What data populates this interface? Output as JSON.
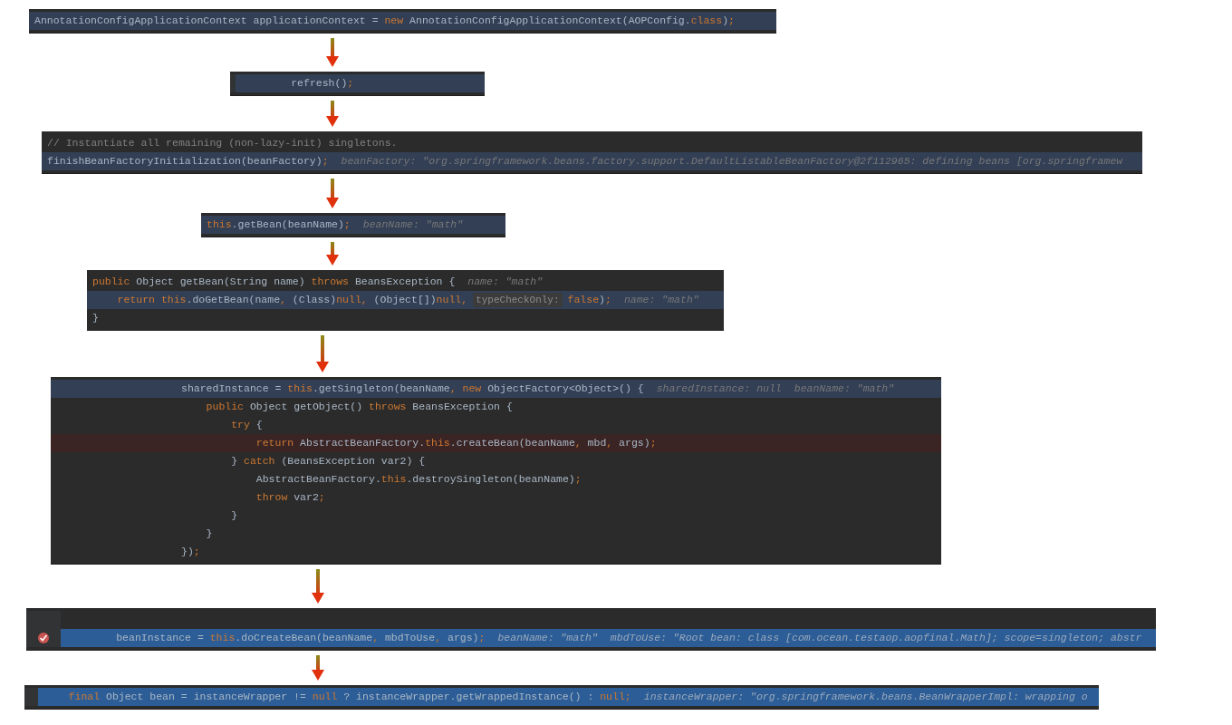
{
  "snippets": [
    {
      "lines": [
        {
          "kind": "caret",
          "parts": [
            {
              "kind": "plain",
              "text": "AnnotationConfigApplicationContext applicationContext = "
            },
            {
              "kind": "keyword",
              "text": "new"
            },
            {
              "kind": "plain",
              "text": " AnnotationConfigApplicationContext(AOPConfig."
            },
            {
              "kind": "keyword",
              "text": "class"
            },
            {
              "kind": "plain",
              "text": ")"
            },
            {
              "kind": "keyword",
              "text": ";"
            }
          ]
        }
      ]
    },
    {
      "lines": [
        {
          "kind": "caret",
          "parts": [
            {
              "kind": "plain",
              "text": "        refresh()"
            },
            {
              "kind": "keyword",
              "text": ";"
            }
          ]
        }
      ]
    },
    {
      "lines": [
        {
          "kind": "normal",
          "parts": [
            {
              "kind": "comment",
              "text": "// Instantiate all remaining (non-lazy-init) singletons."
            }
          ]
        },
        {
          "kind": "caret",
          "parts": [
            {
              "kind": "plain",
              "text": "finishBeanFactoryInitialization(beanFactory)"
            },
            {
              "kind": "keyword",
              "text": ";"
            },
            {
              "kind": "hint",
              "text": "beanFactory: \"org.springframework.beans.factory.support.DefaultListableBeanFactory@2f112965: defining beans [org.springframew"
            }
          ]
        }
      ]
    },
    {
      "lines": [
        {
          "kind": "caret",
          "parts": [
            {
              "kind": "keyword",
              "text": "this"
            },
            {
              "kind": "plain",
              "text": ".getBean(beanName)"
            },
            {
              "kind": "keyword",
              "text": ";"
            },
            {
              "kind": "hint",
              "text": "beanName: \"math\""
            }
          ]
        }
      ]
    },
    {
      "lines": [
        {
          "kind": "normal",
          "parts": [
            {
              "kind": "keyword",
              "text": "public"
            },
            {
              "kind": "plain",
              "text": " Object getBean(String name) "
            },
            {
              "kind": "keyword",
              "text": "throws"
            },
            {
              "kind": "plain",
              "text": " BeansException {"
            },
            {
              "kind": "hint",
              "text": "name: \"math\""
            }
          ]
        },
        {
          "kind": "caret",
          "parts": [
            {
              "kind": "keyword",
              "text": "    return this"
            },
            {
              "kind": "plain",
              "text": ".doGetBean(name"
            },
            {
              "kind": "keyword",
              "text": ","
            },
            {
              "kind": "plain",
              "text": " (Class)"
            },
            {
              "kind": "keyword",
              "text": "null,"
            },
            {
              "kind": "plain",
              "text": " (Object[])"
            },
            {
              "kind": "keyword",
              "text": "null,"
            },
            {
              "kind": "param_hint",
              "text": "typeCheckOnly:"
            },
            {
              "kind": "keyword",
              "text": "false"
            },
            {
              "kind": "plain",
              "text": ")"
            },
            {
              "kind": "keyword",
              "text": ";"
            },
            {
              "kind": "hint",
              "text": "name: \"math\""
            }
          ]
        },
        {
          "kind": "normal",
          "parts": [
            {
              "kind": "plain",
              "text": "}"
            }
          ]
        }
      ]
    },
    {
      "lines": [
        {
          "kind": "caret",
          "parts": [
            {
              "kind": "plain",
              "text": "                    sharedInstance = "
            },
            {
              "kind": "keyword",
              "text": "this"
            },
            {
              "kind": "plain",
              "text": ".getSingleton(beanName"
            },
            {
              "kind": "keyword",
              "text": ", new"
            },
            {
              "kind": "plain",
              "text": " ObjectFactory<Object>() {"
            },
            {
              "kind": "hint",
              "text": "sharedInstance: null"
            },
            {
              "kind": "hint",
              "text": "beanName: \"math\""
            }
          ]
        },
        {
          "kind": "normal",
          "parts": [
            {
              "kind": "keyword",
              "text": "                        public"
            },
            {
              "kind": "plain",
              "text": " Object getObject() "
            },
            {
              "kind": "keyword",
              "text": "throws"
            },
            {
              "kind": "plain",
              "text": " BeansException {"
            }
          ]
        },
        {
          "kind": "normal",
          "parts": [
            {
              "kind": "keyword",
              "text": "                            try"
            },
            {
              "kind": "plain",
              "text": " {"
            }
          ]
        },
        {
          "kind": "breakpoint",
          "parts": [
            {
              "kind": "keyword",
              "text": "                                return"
            },
            {
              "kind": "plain",
              "text": " AbstractBeanFactory."
            },
            {
              "kind": "keyword",
              "text": "this"
            },
            {
              "kind": "plain",
              "text": ".createBean(beanName"
            },
            {
              "kind": "keyword",
              "text": ","
            },
            {
              "kind": "plain",
              "text": " mbd"
            },
            {
              "kind": "keyword",
              "text": ","
            },
            {
              "kind": "plain",
              "text": " args)"
            },
            {
              "kind": "keyword",
              "text": ";"
            }
          ]
        },
        {
          "kind": "normal",
          "parts": [
            {
              "kind": "plain",
              "text": "                            } "
            },
            {
              "kind": "keyword",
              "text": "catch"
            },
            {
              "kind": "plain",
              "text": " (BeansException var2) {"
            }
          ]
        },
        {
          "kind": "normal",
          "parts": [
            {
              "kind": "plain",
              "text": "                                AbstractBeanFactory."
            },
            {
              "kind": "keyword",
              "text": "this"
            },
            {
              "kind": "plain",
              "text": ".destroySingleton(beanName)"
            },
            {
              "kind": "keyword",
              "text": ";"
            }
          ]
        },
        {
          "kind": "normal",
          "parts": [
            {
              "kind": "keyword",
              "text": "                                throw"
            },
            {
              "kind": "plain",
              "text": " var2"
            },
            {
              "kind": "keyword",
              "text": ";"
            }
          ]
        },
        {
          "kind": "normal",
          "parts": [
            {
              "kind": "plain",
              "text": "                            }"
            }
          ]
        },
        {
          "kind": "normal",
          "parts": [
            {
              "kind": "plain",
              "text": "                        }"
            }
          ]
        },
        {
          "kind": "normal",
          "parts": [
            {
              "kind": "plain",
              "text": "                    })"
            },
            {
              "kind": "keyword",
              "text": ";"
            }
          ]
        }
      ]
    },
    {
      "lines": [
        {
          "kind": "normal"
        },
        {
          "kind": "selected",
          "breakpoint_marker": true,
          "parts": [
            {
              "kind": "plain",
              "text": "        beanInstance = "
            },
            {
              "kind": "keyword",
              "text": "this"
            },
            {
              "kind": "plain",
              "text": ".doCreateBean(beanName"
            },
            {
              "kind": "keyword",
              "text": ","
            },
            {
              "kind": "plain",
              "text": " mbdToUse"
            },
            {
              "kind": "keyword",
              "text": ","
            },
            {
              "kind": "plain",
              "text": " args)"
            },
            {
              "kind": "keyword",
              "text": ";"
            },
            {
              "kind": "hint",
              "text": "beanName: \"math\""
            },
            {
              "kind": "hint",
              "text": "mbdToUse: \"Root bean: class [com.ocean.testaop.aopfinal.Math]; scope=singleton; abstr"
            }
          ]
        }
      ]
    },
    {
      "lines": [
        {
          "kind": "selected",
          "parts": [
            {
              "kind": "keyword",
              "text": "    final"
            },
            {
              "kind": "plain",
              "text": " Object bean = instanceWrapper != "
            },
            {
              "kind": "keyword",
              "text": "null"
            },
            {
              "kind": "plain",
              "text": " ? instanceWrapper.getWrappedInstance() : "
            },
            {
              "kind": "keyword",
              "text": "null;"
            },
            {
              "kind": "hint",
              "text": "instanceWrapper: \"org.springframework.beans.BeanWrapperImpl: wrapping o"
            }
          ]
        }
      ]
    }
  ]
}
